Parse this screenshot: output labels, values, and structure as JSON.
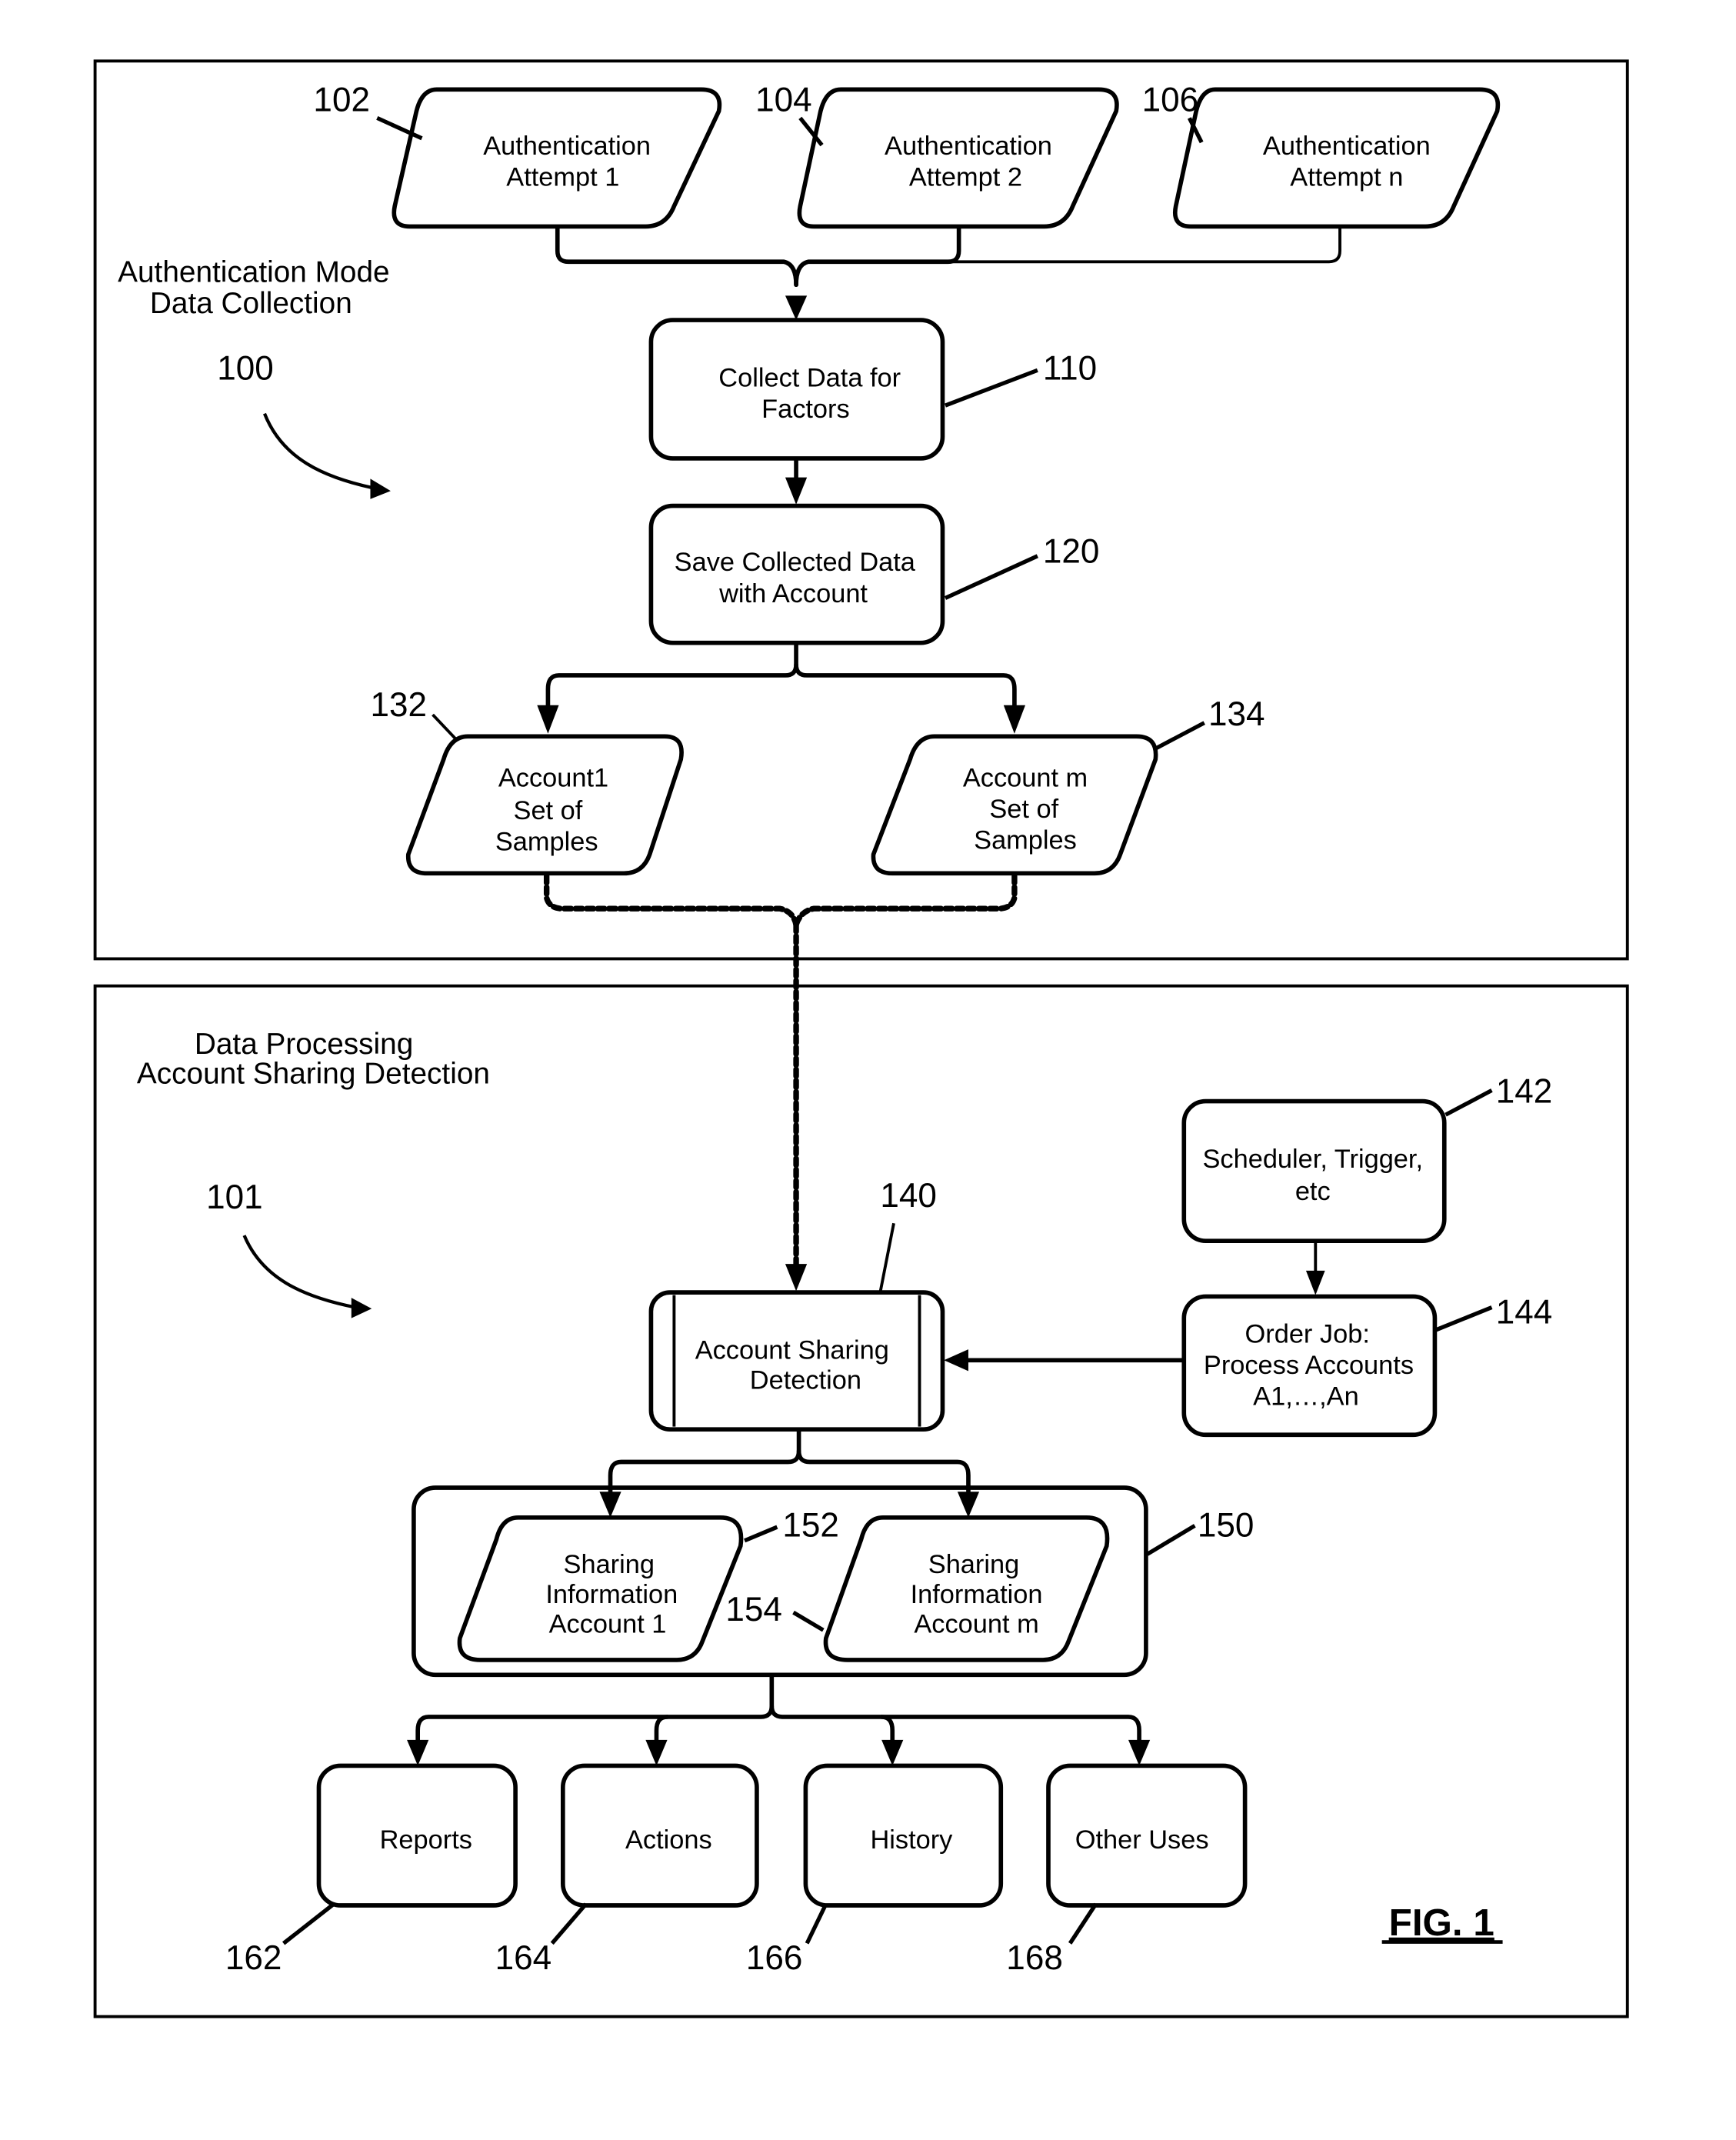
{
  "figure": {
    "label": "FIG. 1"
  },
  "section_top": {
    "title_line1": "Authentication Mode",
    "title_line2": "Data Collection",
    "ref": "100"
  },
  "section_bottom": {
    "title_line1": "Data Processing",
    "title_line2": "Account Sharing Detection",
    "ref": "101"
  },
  "nodes": {
    "attempt1": {
      "ref": "102",
      "line1": "Authentication",
      "line2": "Attempt 1"
    },
    "attempt2": {
      "ref": "104",
      "line1": "Authentication",
      "line2": "Attempt 2"
    },
    "attemptn": {
      "ref": "106",
      "line1": "Authentication",
      "line2": "Attempt  n"
    },
    "collect": {
      "ref": "110",
      "line1": "Collect Data for",
      "line2": "Factors"
    },
    "save": {
      "ref": "120",
      "line1": "Save Collected Data",
      "line2": "with Account"
    },
    "account1": {
      "ref": "132",
      "line1": "Account1",
      "line2": "Set of",
      "line3": "Samples"
    },
    "accountm": {
      "ref": "134",
      "line1": "Account m",
      "line2": "Set of",
      "line3": "Samples"
    },
    "detection": {
      "ref": "140",
      "line1": "Account Sharing",
      "line2": "Detection"
    },
    "scheduler": {
      "ref": "142",
      "line1": "Scheduler, Trigger,",
      "line2": "etc"
    },
    "orderjob": {
      "ref": "144",
      "line1": "Order Job:",
      "line2": "Process Accounts",
      "line3": "A1,…,An"
    },
    "sharing_group": {
      "ref": "150"
    },
    "sharing1": {
      "ref": "152",
      "line1": "Sharing",
      "line2": "Information",
      "line3": "Account 1"
    },
    "sharingm": {
      "ref": "154",
      "line1": "Sharing",
      "line2": "Information",
      "line3": "Account  m"
    },
    "reports": {
      "ref": "162",
      "label": "Reports"
    },
    "actions": {
      "ref": "164",
      "label": "Actions"
    },
    "history": {
      "ref": "166",
      "label": "History"
    },
    "other": {
      "ref": "168",
      "label": "Other Uses"
    }
  }
}
